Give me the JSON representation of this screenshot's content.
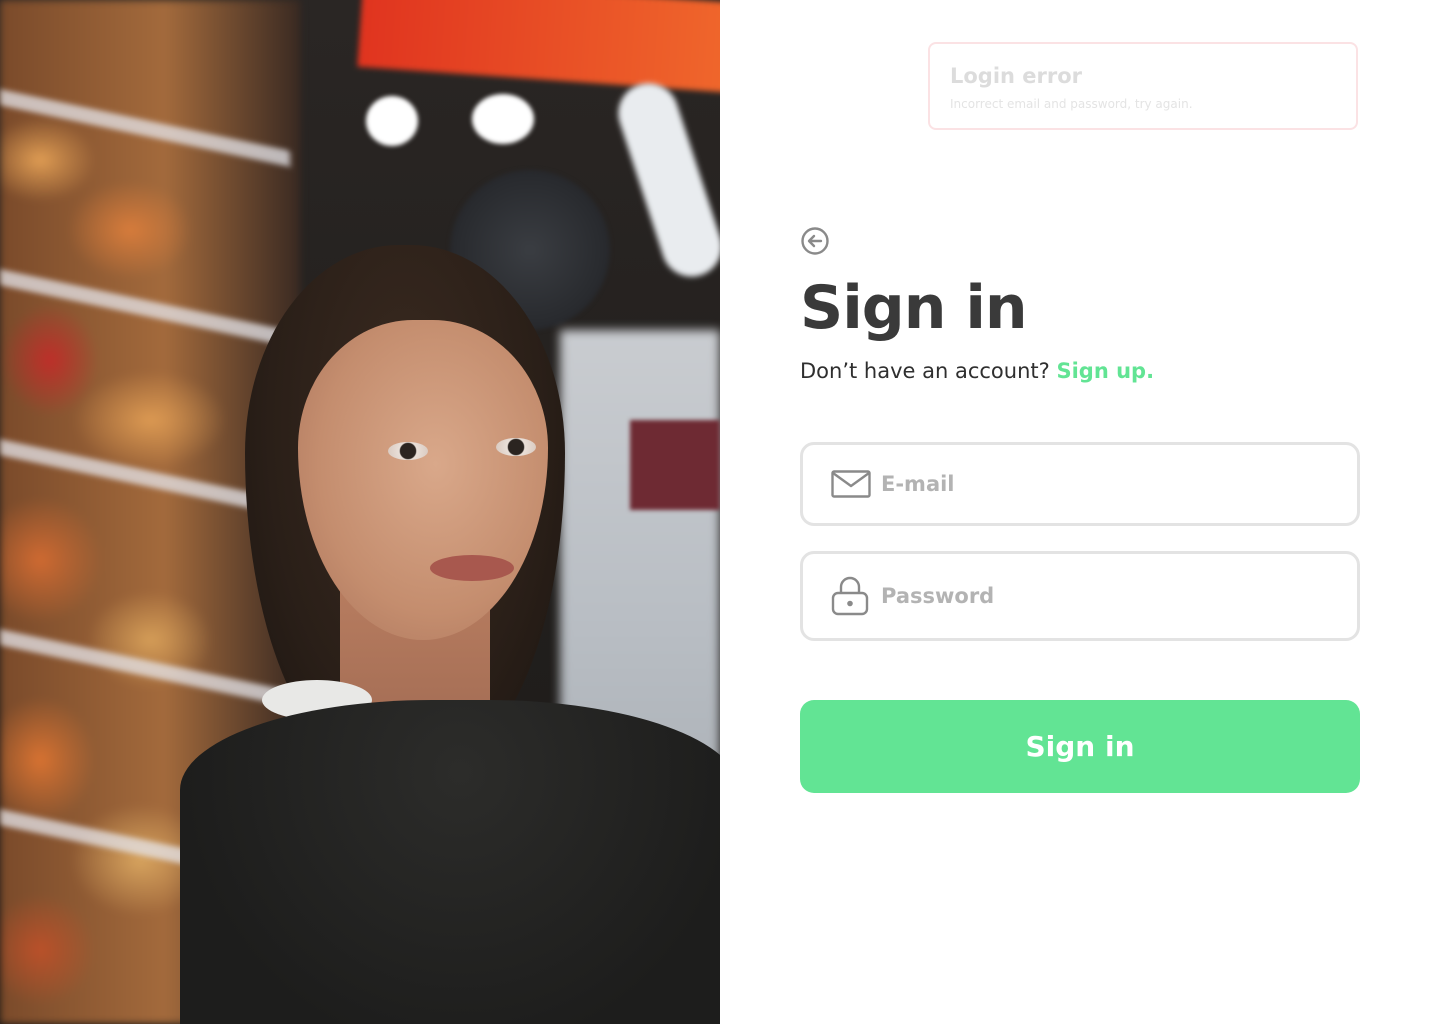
{
  "error_toast": {
    "title": "Login error",
    "message": "Incorrect email and password, try again."
  },
  "back_button": {
    "icon": "arrow-left-circle-icon"
  },
  "heading": "Sign in",
  "subtitle": {
    "prompt": "Don’t have an account?",
    "link_label": "Sign up."
  },
  "form": {
    "email": {
      "placeholder": "E-mail",
      "value": "",
      "icon": "envelope-icon"
    },
    "password": {
      "placeholder": "Password",
      "value": "",
      "icon": "lock-icon"
    },
    "submit_label": "Sign in"
  },
  "colors": {
    "accent": "#62e494",
    "text_dark": "#3a3a3a",
    "field_border": "#e3e3e3",
    "error_border": "#fbe2e4"
  }
}
